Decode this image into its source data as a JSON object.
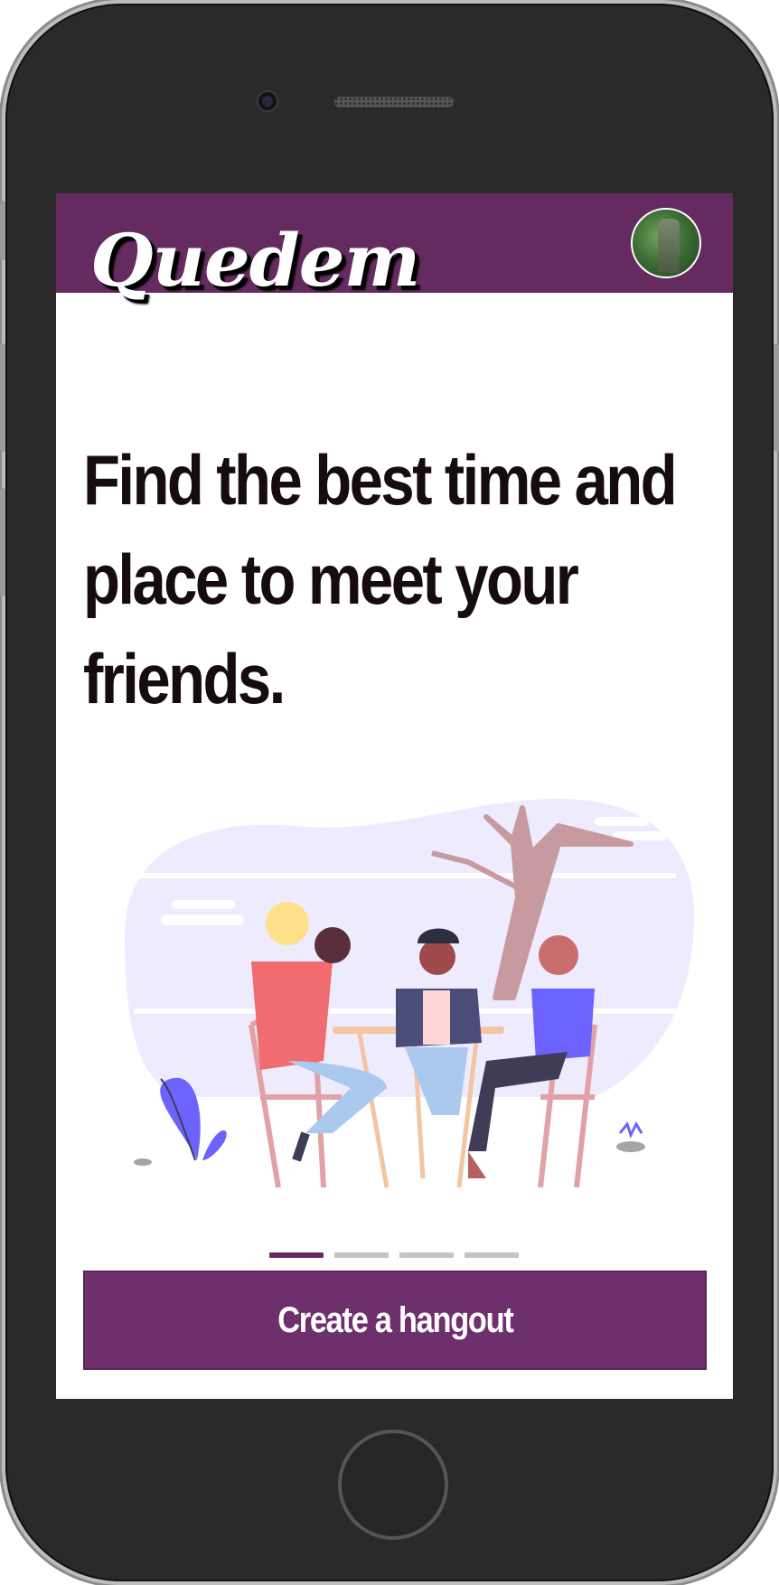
{
  "app": {
    "logo_text": "Quedem",
    "headline": "Find the best time and place to meet your friends.",
    "cta_label": "Create a hangout",
    "avatar_icon": "profile-avatar-icon",
    "carousel": {
      "page_count": 4,
      "active_index": 0
    }
  },
  "colors": {
    "brand": "#652b60",
    "button": "#6e306c",
    "text": "#150b10",
    "dot_inactive": "#c4c4c4"
  }
}
